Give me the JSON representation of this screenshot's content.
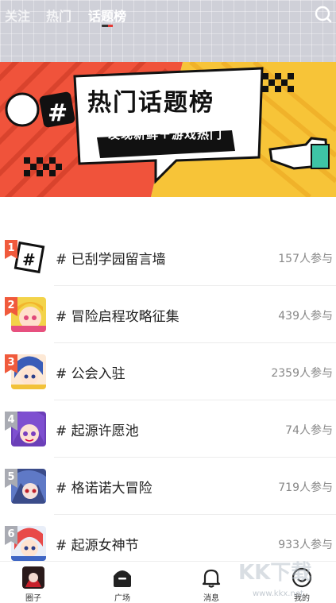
{
  "header": {
    "tabs": [
      {
        "label": "关注"
      },
      {
        "label": "热门"
      },
      {
        "label": "话题榜"
      }
    ],
    "active_tab": "话题榜",
    "search_icon": "search-icon"
  },
  "banner": {
    "title": "热门话题榜",
    "subtitle": "发现新鲜＋游戏热门"
  },
  "topics": [
    {
      "rank": "1",
      "title": "# 已刮学园留言墙",
      "count": "157人参与"
    },
    {
      "rank": "2",
      "title": "# 冒险启程攻略征集",
      "count": "439人参与"
    },
    {
      "rank": "3",
      "title": "# 公会入驻",
      "count": "2359人参与"
    },
    {
      "rank": "4",
      "title": "# 起源许愿池",
      "count": "74人参与"
    },
    {
      "rank": "5",
      "title": "# 格诺诺大冒险",
      "count": "719人参与"
    },
    {
      "rank": "6",
      "title": "# 起源女神节",
      "count": "933人参与"
    }
  ],
  "bottom_nav": [
    {
      "label": "圈子",
      "icon": "circle-avatar-icon"
    },
    {
      "label": "广场",
      "icon": "plaza-icon"
    },
    {
      "label": "消息",
      "icon": "bell-icon"
    },
    {
      "label": "我的",
      "icon": "profile-icon"
    }
  ],
  "watermark": {
    "text": "KK下载",
    "url": "www.kkx.net"
  },
  "colors": {
    "hot_rank": "#f05a3c",
    "normal_rank": "#a9abb3",
    "accent_red": "#e53935"
  }
}
